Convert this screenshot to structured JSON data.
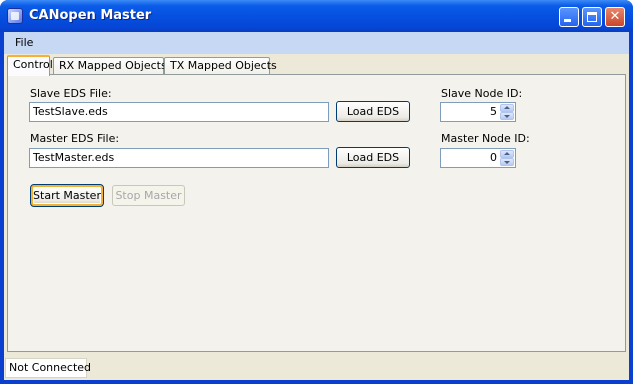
{
  "window": {
    "title": "CANopen Master"
  },
  "menu": {
    "file": "File"
  },
  "tabs": [
    {
      "label": "Control"
    },
    {
      "label": "RX Mapped Objects"
    },
    {
      "label": "TX Mapped Objects"
    }
  ],
  "control": {
    "slave_eds_label": "Slave EDS File:",
    "slave_eds_value": "TestSlave.eds",
    "load_eds_label": "Load EDS",
    "master_eds_label": "Master EDS File:",
    "master_eds_value": "TestMaster.eds",
    "slave_node_label": "Slave Node ID:",
    "slave_node_value": "5",
    "master_node_label": "Master Node ID:",
    "master_node_value": "0",
    "start_master": "Start Master",
    "stop_master": "Stop Master"
  },
  "status": {
    "text": "Not Connected"
  },
  "colors": {
    "titlebar": "#0650e0",
    "menubar": "#c7d8f5",
    "panel": "#f3f2ec",
    "active_tab_accent": "#f7b035"
  }
}
